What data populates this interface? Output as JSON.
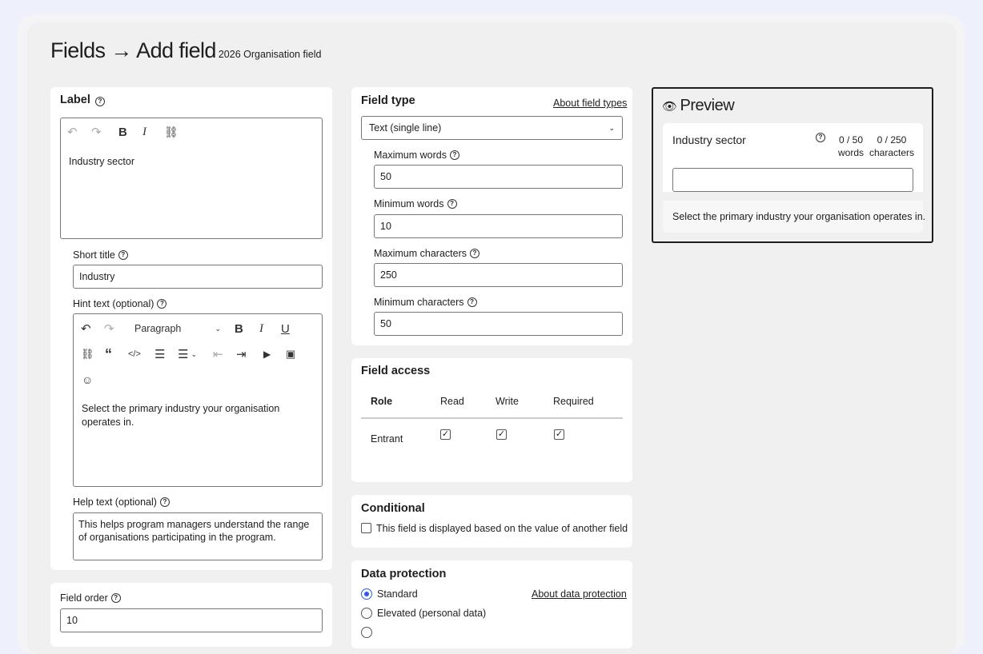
{
  "breadcrumb": {
    "part1": "Fields",
    "arrow": "→",
    "part2": "Add field",
    "subtitle": "2026 Organisation field"
  },
  "label_section": {
    "heading": "Label",
    "value": "Industry sector",
    "short_title_label": "Short title",
    "short_title_value": "Industry",
    "hint_label": "Hint text (optional)",
    "hint_format": "Paragraph",
    "hint_value": "Select the primary industry your organisation operates in.",
    "help_label": "Help text (optional)",
    "help_value": "This helps program managers understand the range of organisations participating in the program."
  },
  "field_order": {
    "label": "Field order",
    "value": "10"
  },
  "field_type": {
    "heading": "Field type",
    "link": "About field types",
    "selected": "Text (single line)",
    "max_words_label": "Maximum words",
    "max_words": "50",
    "min_words_label": "Minimum words",
    "min_words": "10",
    "max_chars_label": "Maximum characters",
    "max_chars": "250",
    "min_chars_label": "Minimum characters",
    "min_chars": "50"
  },
  "field_access": {
    "heading": "Field access",
    "columns": [
      "Role",
      "Read",
      "Write",
      "Required"
    ],
    "rows": [
      {
        "role": "Entrant",
        "read": true,
        "write": true,
        "required": true
      }
    ]
  },
  "conditional": {
    "heading": "Conditional",
    "checkbox_label": "This field is displayed based on the value of another field"
  },
  "data_protection": {
    "heading": "Data protection",
    "link": "About data protection",
    "options": [
      "Standard",
      "Elevated (personal data)"
    ],
    "selected": "Standard"
  },
  "preview": {
    "heading": "Preview",
    "field_label": "Industry sector",
    "words_count": "0 / 50",
    "words_unit": "words",
    "chars_count": "0 / 250",
    "chars_unit": "characters",
    "hint": "Select the primary industry your organisation operates in."
  },
  "icons": [
    "eye-icon",
    "help-icon",
    "undo-icon",
    "redo-icon",
    "bold-icon",
    "italic-icon",
    "underline-icon",
    "link-icon",
    "quote-icon",
    "code-icon",
    "bullet-list-icon",
    "numbered-list-icon",
    "outdent-icon",
    "indent-icon",
    "video-icon",
    "image-icon",
    "emoji-icon",
    "chevron-down-icon"
  ],
  "colors": {
    "accent": "#2d5be3",
    "page_bg": "#eef0fb",
    "panel_bg": "#f0f0f0"
  }
}
